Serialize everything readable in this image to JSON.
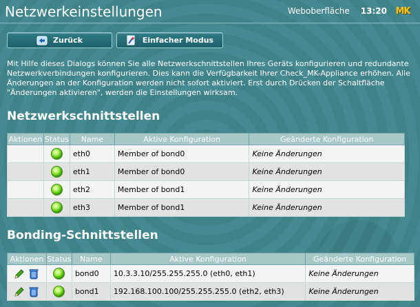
{
  "header": {
    "title": "Netzwerkeinstellungen",
    "web_link": "Weboberfläche",
    "time": "13:20",
    "logo_text": "MK"
  },
  "buttons": {
    "back": "Zurück",
    "simple_mode": "Einfacher Modus"
  },
  "intro": "Mit Hilfe dieses Dialogs können Sie alle Netzwerkschnittstellen Ihres Geräts konfigurieren und redundante Netzwerkverbindungen konfigurieren. Dies kann die Verfügbarkeit Ihrer Check_MK-Appliance erhöhen. Alle Änderungen an der Konfiguration werden nicht sofort aktiviert. Erst durch Drücken der Schaltfläche \"Änderungen aktivieren\", werden die Einstellungen wirksam.",
  "interfaces": {
    "title": "Netzwerkschnittstellen",
    "columns": [
      "Aktionen",
      "Status",
      "Name",
      "Aktive Konfiguration",
      "Geänderte Konfiguration"
    ],
    "rows": [
      {
        "name": "eth0",
        "active": "Member of bond0",
        "changed": "Keine Änderungen"
      },
      {
        "name": "eth1",
        "active": "Member of bond0",
        "changed": "Keine Änderungen"
      },
      {
        "name": "eth2",
        "active": "Member of bond1",
        "changed": "Keine Änderungen"
      },
      {
        "name": "eth3",
        "active": "Member of bond1",
        "changed": "Keine Änderungen"
      }
    ]
  },
  "bonding": {
    "title": "Bonding-Schnittstellen",
    "columns": [
      "Aktionen",
      "Status",
      "Name",
      "Aktive Konfiguration",
      "Geänderte Konfiguration"
    ],
    "rows": [
      {
        "name": "bond0",
        "active": "10.3.3.10/255.255.255.0 (eth0, eth1)",
        "changed": "Keine Änderungen"
      },
      {
        "name": "bond1",
        "active": "192.168.100.100/255.255.255.0 (eth2, eth3)",
        "changed": "Keine Änderungen"
      }
    ]
  },
  "colors": {
    "background": "#3f8288",
    "status_ok": "#7fdc2a",
    "logo": "#ffc21a"
  },
  "icons": {
    "back": "arrow-left-icon",
    "simple_mode": "wizard-icon",
    "edit": "pencil-icon",
    "delete": "trash-icon",
    "status": "status-ok-icon"
  }
}
